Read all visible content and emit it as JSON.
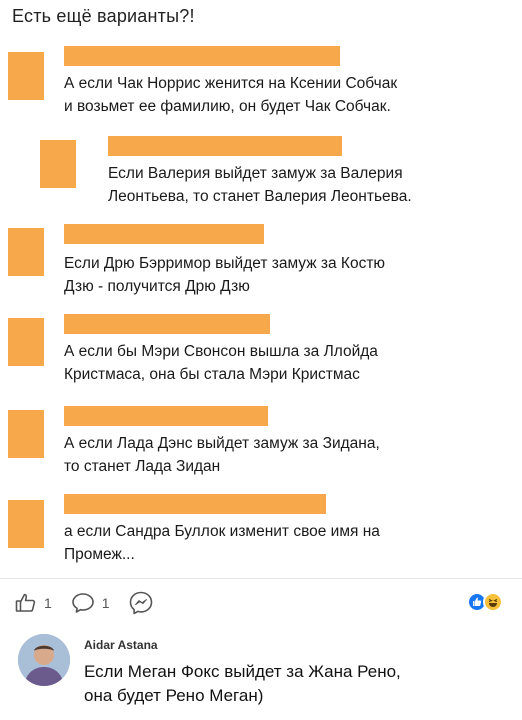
{
  "post": {
    "header": "Есть ещё варианты?!"
  },
  "comments": [
    {
      "text": "А если Чак Норрис женится на Ксении Собчак\nи возьмет ее фамилию, он будет Чак Собчак."
    },
    {
      "text": "Если Валерия выйдет замуж за Валерия\nЛеонтьева, то станет Валерия Леонтьева."
    },
    {
      "text": "Если Дрю Бэрримор выйдет замуж за Костю\nДзю - получится Дрю Дзю"
    },
    {
      "text": "А если бы Мэри Свонсон вышла за Ллойда\nКристмаса, она бы стала Мэри Кристмас"
    },
    {
      "text": "А если Лада Дэнс выйдет замуж за Зидана,\nто станет Лада Зидан"
    },
    {
      "text": "а если Сандра Буллок изменит свое имя на\nПромеж..."
    }
  ],
  "actions": {
    "like_count": "1",
    "comment_count": "1"
  },
  "icons": {
    "like": "thumbs-up-icon",
    "comment": "comment-bubble-icon",
    "share": "messenger-icon",
    "reaction_like": "like-reaction-icon",
    "reaction_haha": "haha-reaction-icon"
  },
  "colors": {
    "redaction": "#f7a84a",
    "like_blue": "#1877f2",
    "haha_yellow": "#f7c13b"
  },
  "reply": {
    "author": "Aidar Astana",
    "text": "Если Меган Фокс выйдет за Жана Рено,\nона будет Рено Меган)"
  }
}
